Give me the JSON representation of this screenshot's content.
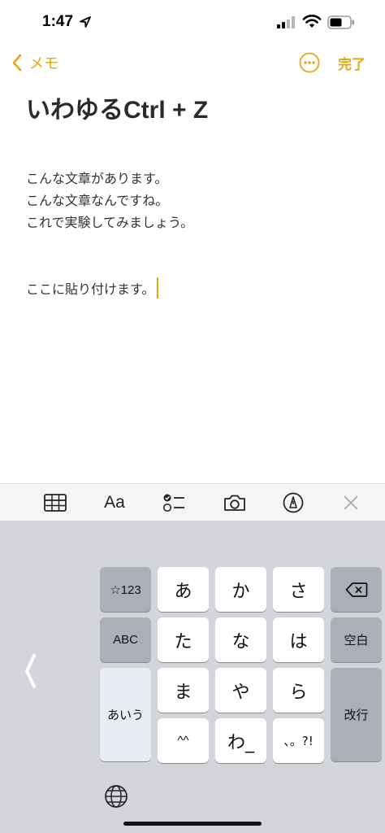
{
  "status_bar": {
    "time": "1:47"
  },
  "nav": {
    "back_label": "メモ",
    "faded_title": "",
    "done_label": "完了"
  },
  "note": {
    "title": "いわゆるCtrl + Z",
    "lines": [
      "こんな文章があります。",
      "こんな文章なんですね。",
      "これで実験してみましょう。"
    ],
    "paste_line": "ここに貼り付けます。"
  },
  "toolbar": {
    "format_label": "Aa"
  },
  "keyboard": {
    "symbols_key": "☆123",
    "abc_key": "ABC",
    "hiragana_key": "あいう",
    "kana_keys": [
      "あ",
      "か",
      "さ",
      "た",
      "な",
      "は",
      "ま",
      "や",
      "ら",
      "^^",
      "わ_",
      "、。?!"
    ],
    "space_key": "空白",
    "return_key": "改行"
  },
  "colors": {
    "accent": "#e3a812",
    "keyboard_bg": "#d3d5db",
    "toolbar_bg": "#f5f5f7"
  }
}
